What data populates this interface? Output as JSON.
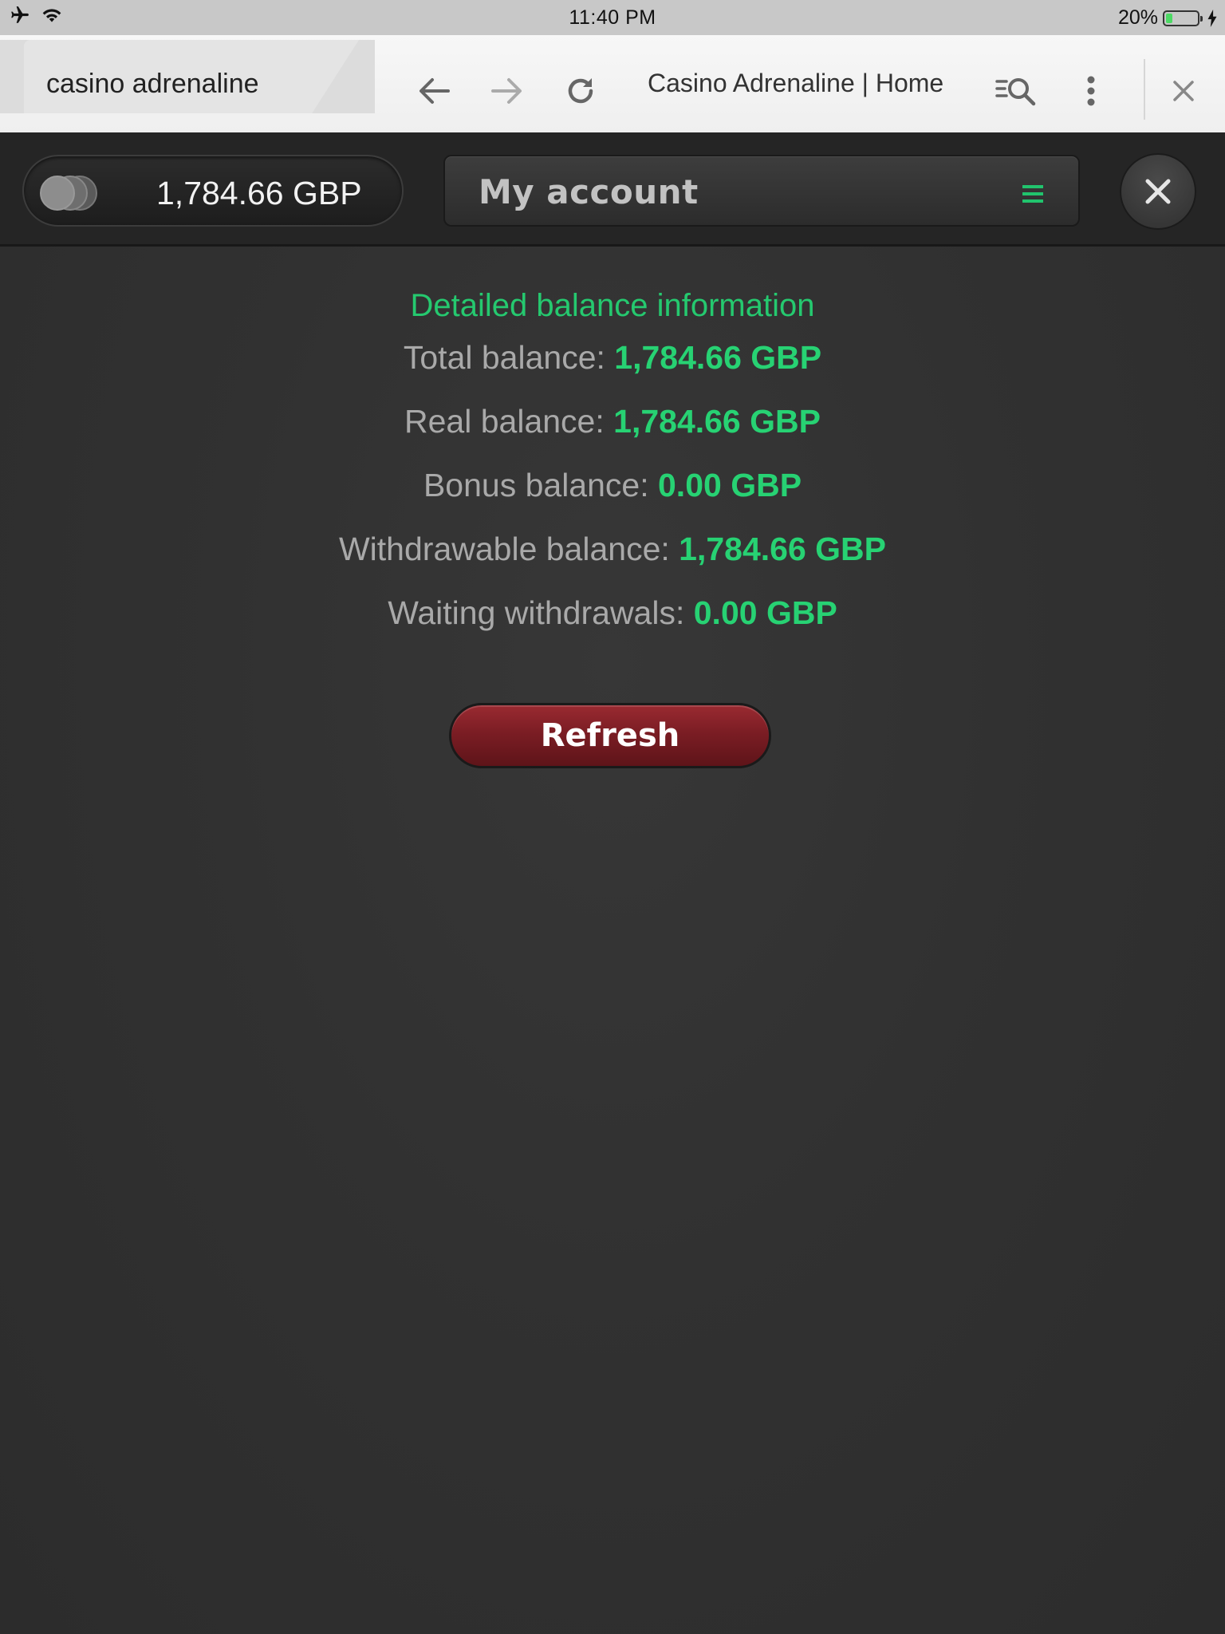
{
  "status_bar": {
    "time": "11:40 PM",
    "battery_percent": "20%",
    "battery_level": 0.2
  },
  "browser": {
    "tab_title": "casino adrenaline",
    "page_title": "Casino Adrenaline | Home",
    "icons": [
      "back-arrow-icon",
      "forward-arrow-icon",
      "reload-icon",
      "find-in-page-icon",
      "more-vertical-icon",
      "close-icon"
    ]
  },
  "header": {
    "balance": "1,784.66 GBP",
    "account_label": "My account"
  },
  "balance_info": {
    "title": "Detailed balance information",
    "rows": [
      {
        "label": "Total balance: ",
        "value": "1,784.66 GBP"
      },
      {
        "label": "Real balance: ",
        "value": "1,784.66 GBP"
      },
      {
        "label": "Bonus balance: ",
        "value": "0.00 GBP"
      },
      {
        "label": "Withdrawable balance: ",
        "value": "1,784.66 GBP"
      },
      {
        "label": "Waiting withdrawals: ",
        "value": "0.00 GBP"
      }
    ],
    "refresh_label": "Refresh"
  },
  "colors": {
    "accent_green": "#27d273",
    "refresh_red": "#7b1d24",
    "background": "#303030"
  }
}
